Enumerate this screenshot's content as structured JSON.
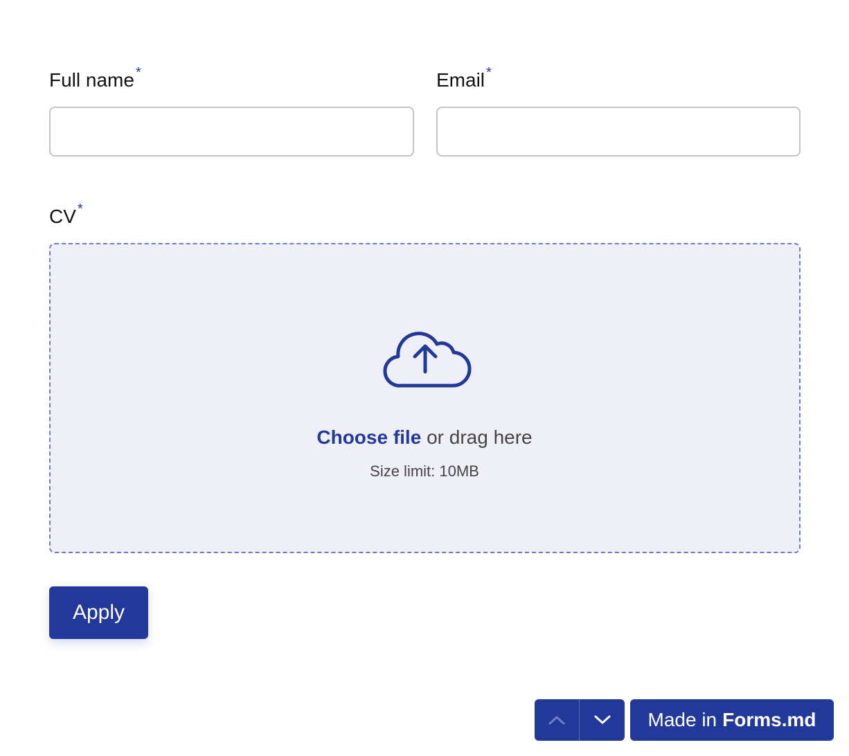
{
  "form": {
    "full_name": {
      "label": "Full name",
      "required_mark": "*",
      "value": ""
    },
    "email": {
      "label": "Email",
      "required_mark": "*",
      "value": ""
    },
    "cv": {
      "label": "CV",
      "required_mark": "*",
      "upload_icon": "cloud-upload-icon",
      "choose_file": "Choose file",
      "drag_text": "or drag here",
      "size_limit": "Size limit: 10MB"
    },
    "submit_label": "Apply"
  },
  "footer": {
    "prev_icon": "chevron-up-icon",
    "next_icon": "chevron-down-icon",
    "made_in_prefix": "Made in",
    "made_in_brand": "Forms.md"
  },
  "colors": {
    "accent": "#23399a",
    "dropzone_bg": "#eeeff7",
    "dropzone_border": "#6f79c4",
    "input_border": "#c4c4c4",
    "muted_text": "#444444"
  }
}
